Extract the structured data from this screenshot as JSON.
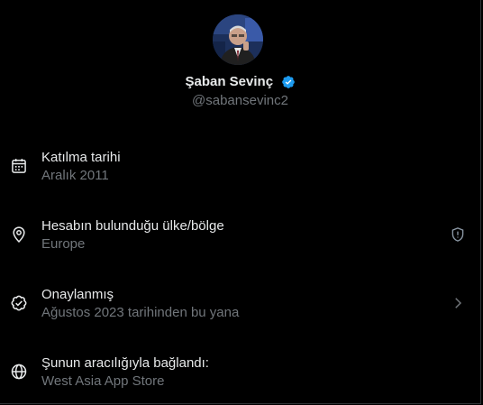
{
  "profile": {
    "display_name": "Şaban Sevinç",
    "handle": "@sabansevinc2",
    "verified": true,
    "verified_color": "#1d9bf0"
  },
  "about": {
    "items": [
      {
        "icon": "calendar-icon",
        "label": "Katılma tarihi",
        "value": "Aralık 2011"
      },
      {
        "icon": "location-pin-icon",
        "label": "Hesabın bulunduğu ülke/bölge",
        "value": "Europe",
        "trailing_icon": "shield-info-icon"
      },
      {
        "icon": "verified-check-icon",
        "label": "Onaylanmış",
        "value": "Ağustos 2023 tarihinden bu yana",
        "trailing_icon": "chevron-right-icon"
      },
      {
        "icon": "globe-icon",
        "label": "Şunun aracılığıyla bağlandı:",
        "value": "West Asia App Store"
      }
    ]
  },
  "colors": {
    "background": "#000000",
    "primary_text": "#e7e9ea",
    "secondary_text": "#71767b",
    "accent": "#1d9bf0"
  }
}
